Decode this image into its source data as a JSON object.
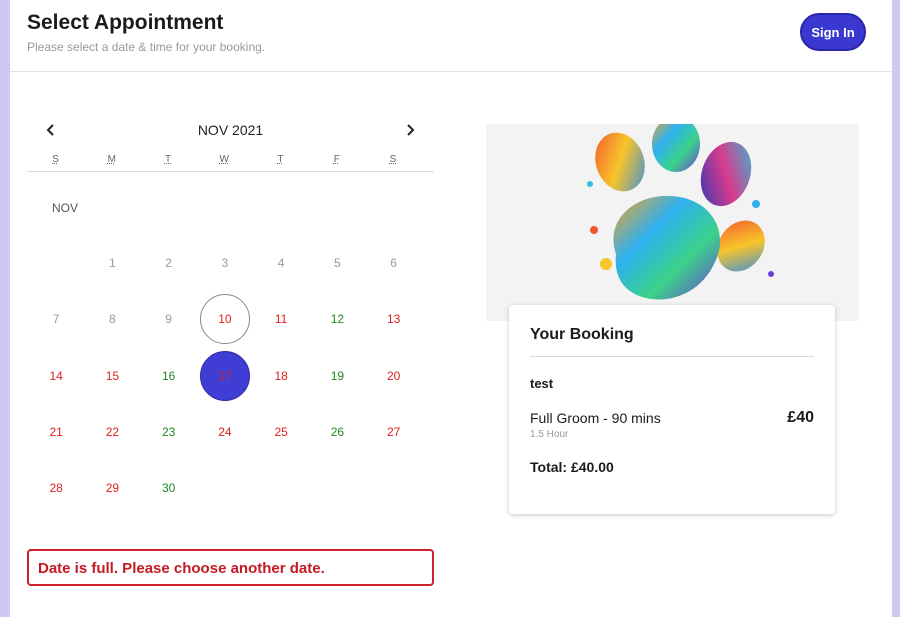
{
  "header": {
    "title": "Select Appointment",
    "subtitle": "Please select a date & time for your booking.",
    "sign_in_label": "Sign In"
  },
  "calendar": {
    "prev_icon": "chevron-left-icon",
    "next_icon": "chevron-right-icon",
    "month_title": "NOV 2021",
    "month_label": "NOV",
    "weekdays": [
      "S",
      "M",
      "T",
      "W",
      "T",
      "F",
      "S"
    ],
    "days": [
      {
        "label": "1",
        "status": "grey"
      },
      {
        "label": "2",
        "status": "grey"
      },
      {
        "label": "3",
        "status": "grey"
      },
      {
        "label": "4",
        "status": "grey"
      },
      {
        "label": "5",
        "status": "grey"
      },
      {
        "label": "6",
        "status": "grey"
      },
      {
        "label": "7",
        "status": "grey"
      },
      {
        "label": "8",
        "status": "grey"
      },
      {
        "label": "9",
        "status": "grey"
      },
      {
        "label": "10",
        "status": "red",
        "today": true
      },
      {
        "label": "11",
        "status": "red"
      },
      {
        "label": "12",
        "status": "green"
      },
      {
        "label": "13",
        "status": "red"
      },
      {
        "label": "14",
        "status": "red"
      },
      {
        "label": "15",
        "status": "red"
      },
      {
        "label": "16",
        "status": "green"
      },
      {
        "label": "17",
        "status": "red",
        "selected": true
      },
      {
        "label": "18",
        "status": "red"
      },
      {
        "label": "19",
        "status": "green"
      },
      {
        "label": "20",
        "status": "red"
      },
      {
        "label": "21",
        "status": "red"
      },
      {
        "label": "22",
        "status": "red"
      },
      {
        "label": "23",
        "status": "green"
      },
      {
        "label": "24",
        "status": "red"
      },
      {
        "label": "25",
        "status": "red"
      },
      {
        "label": "26",
        "status": "green"
      },
      {
        "label": "27",
        "status": "red"
      },
      {
        "label": "28",
        "status": "red"
      },
      {
        "label": "29",
        "status": "red"
      },
      {
        "label": "30",
        "status": "green"
      }
    ]
  },
  "error_message": "Date is full. Please choose another date.",
  "hero_image": "paw-print-splash-image",
  "booking": {
    "title": "Your Booking",
    "pet_name": "test",
    "service": "Full Groom - 90 mins",
    "duration": "1.5 Hour",
    "price": "£40",
    "total": "Total: £40.00"
  },
  "colors": {
    "accent": "#3f3dd4",
    "unavailable": "#e02020",
    "available": "#1e8a1e",
    "error": "#d0202c",
    "background": "#cfc8f3"
  }
}
